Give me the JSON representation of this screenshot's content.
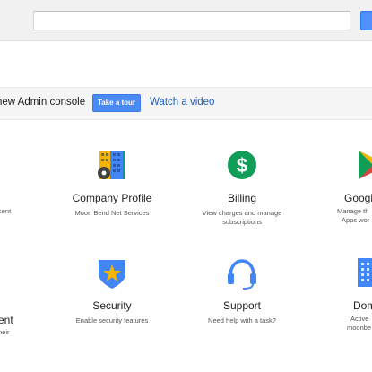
{
  "search": {
    "value": "",
    "placeholder": ""
  },
  "banner": {
    "text": "new Admin console",
    "tour_button": "Take a tour",
    "video_link": "Watch a video"
  },
  "cards": {
    "company_profile": {
      "title": "Company Profile",
      "desc": "Moon Bend Net Services"
    },
    "billing": {
      "title": "Billing",
      "desc": "View charges and manage subscriptions"
    },
    "security": {
      "title": "Security",
      "desc": "Enable security features"
    },
    "support": {
      "title": "Support",
      "desc": "Need help with a task?"
    }
  },
  "partial_left": {
    "top_desc": "sent",
    "bottom_title": "ent",
    "bottom_desc": "heir"
  },
  "partial_right": {
    "top_title": "Googl",
    "top_desc_1": "Manage th",
    "top_desc_2": "Apps wor",
    "bottom_title": "Dom",
    "bottom_desc_1": "Active",
    "bottom_desc_2": "moonbe"
  },
  "icons": {
    "company_profile": "building-icon",
    "billing": "dollar-circle-icon",
    "google_apps": "play-triangle-icon",
    "security": "shield-star-icon",
    "support": "headset-icon",
    "domains": "domain-grid-icon"
  },
  "colors": {
    "accent_blue": "#4a8af4",
    "link_blue": "#1a5fc4",
    "billing_green": "#0f9d58",
    "security_blue": "#4285f4",
    "security_star": "#f4b400"
  }
}
